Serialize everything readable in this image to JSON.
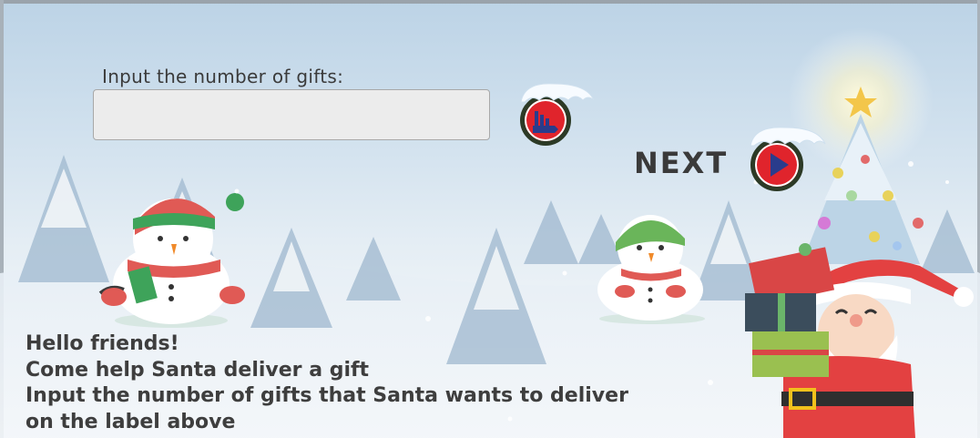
{
  "prompt_label": "Input the number of gifts:",
  "gift_input": {
    "value": "",
    "placeholder": ""
  },
  "next_label": "NEXT",
  "messages": [
    "Hello friends!",
    "Come help Santa deliver a gift",
    "Input the number of gifts that Santa wants to deliver",
    "on the label above"
  ],
  "icons": {
    "submit_button": "bar-chart-icon",
    "next_button": "play-icon"
  },
  "colors": {
    "button_red": "#e0242c",
    "button_ring": "#2c3a26",
    "icon_blue": "#2a3c8c",
    "text": "#3e3e3e"
  }
}
